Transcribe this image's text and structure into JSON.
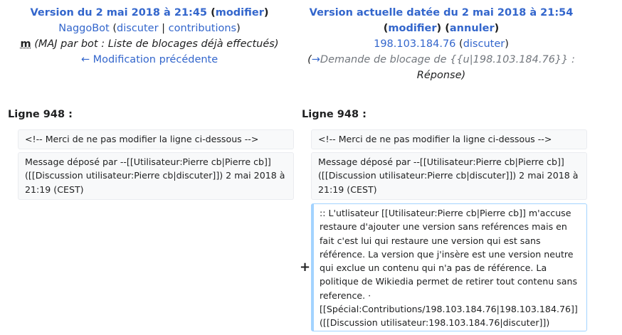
{
  "left_header": {
    "version_title": "Version du 2 mai 2018 à 21:45",
    "edit_link": "modifier",
    "user": "NaggoBot",
    "talk_link": "discuter",
    "separator": "|",
    "contribs_link": "contributions",
    "minor_flag": "m",
    "summary": "(MAJ par bot : Liste de blocages déjà effectués)",
    "prev_link": "← Modification précédente"
  },
  "right_header": {
    "version_title": "Version actuelle datée du 2 mai 2018 à 21:54",
    "edit_link": "modifier",
    "undo_link": "annuler",
    "ip": "198.103.184.76",
    "talk_link": "discuter",
    "summary_arrow": "→",
    "summary_section": "Demande de blocage de {{u|198.103.184.76}} :",
    "summary_text": "Réponse"
  },
  "diff": {
    "left_line_label": "Ligne 948 :",
    "right_line_label": "Ligne 948 :",
    "context_line_1": "<!-- Merci de ne pas modifier la ligne ci-dessous -->",
    "context_line_2": "Message déposé par --[[Utilisateur:Pierre cb|Pierre cb]] ([[Discussion utilisateur:Pierre cb|discuter]]) 2 mai 2018 à 21:19 (CEST)",
    "added_marker": "+",
    "added_line": ":: L'utlisateur [[Utilisateur:Pierre cb|Pierre cb]] m'accuse restaure d'ajouter une version sans reférences mais en fait c'est lui qui restaure une version qui est sans référence. La version que j'insère est une version neutre qui exclue un contenu qui n'a pas de référence. La politique de Wikiedia permet de retirer tout contenu sans reference. · [[Spécial:Contributions/198.103.184.76|198.103.184.76]] ([[Discussion utilisateur:198.103.184.76|discuter]])"
  },
  "colors": {
    "link": "#3366cc",
    "context_bg": "#f8f9fa",
    "added_border": "#a3d3ff"
  }
}
